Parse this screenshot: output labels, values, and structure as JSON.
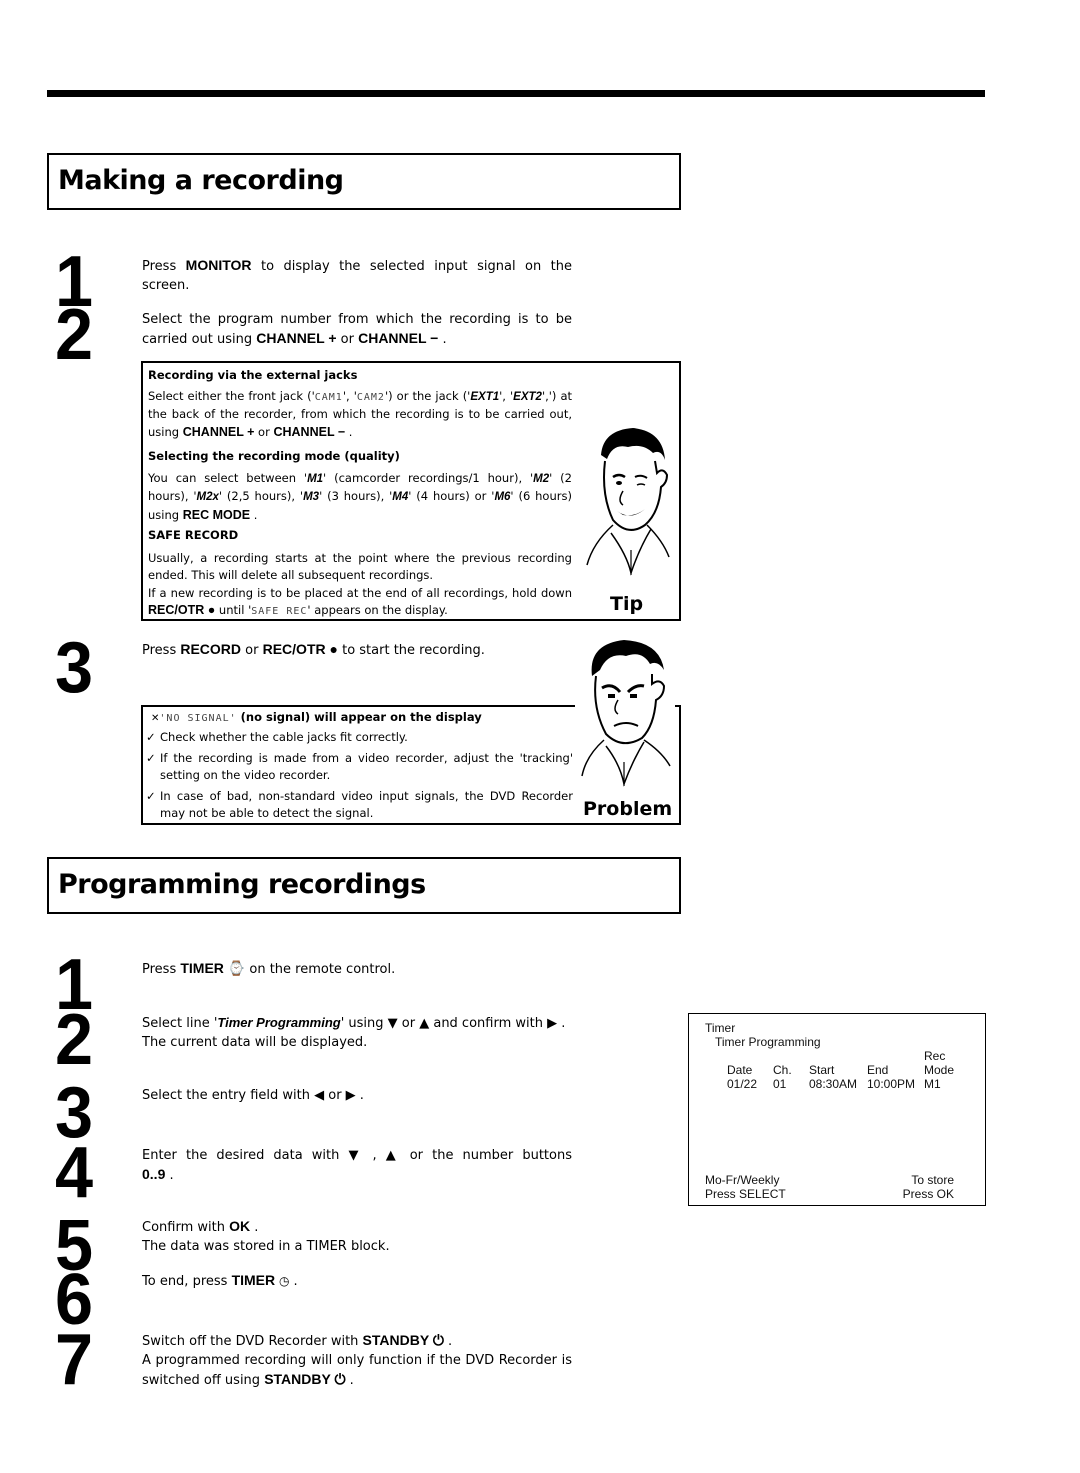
{
  "section1": {
    "title": "Making a recording",
    "steps": [
      {
        "num": "1",
        "pre": "Press ",
        "key": "MONITOR",
        "post": " to display the selected input signal on the screen."
      },
      {
        "num": "2",
        "pre": "Select the program number from which the recording is to be carried out using ",
        "key1": "CHANNEL +",
        "mid": " or ",
        "key2": "CHANNEL −",
        "post": " ."
      },
      {
        "num": "3",
        "pre": "Press ",
        "key1": "RECORD",
        "mid": " or ",
        "key2": "REC/OTR ●",
        "post": " to start the recording."
      }
    ],
    "tip": {
      "label": "Tip",
      "blocks": [
        {
          "heading": "Recording via the external jacks",
          "text_a": "Select either the front jack ('",
          "lcd1": "CAM1",
          "text_b": "', '",
          "lcd2": "CAM2",
          "text_c": "') or the jack ('",
          "bi1": "EXT1",
          "text_d": "', '",
          "bi2": "EXT2",
          "text_e": "',') at the back of the recorder, from which the recording is to be carried out, using ",
          "key1": "CHANNEL +",
          "mid": " or ",
          "key2": "CHANNEL −",
          "end": " ."
        },
        {
          "heading": "Selecting the recording mode (quality)",
          "text": "You can select between 'M1' (camcorder recordings/1 hour), 'M2' (2 hours), 'M2x' (2,5 hours), 'M3' (3 hours), 'M4' (4 hours) or 'M6' (6 hours) using",
          "modes": [
            "M1",
            "M2",
            "M2x",
            "M3",
            "M4",
            "M6"
          ],
          "mode_desc": [
            "camcorder recordings/1 hour",
            "2 hours",
            "2,5 hours",
            "3 hours",
            "4 hours",
            "6 hours"
          ],
          "key": "REC MODE"
        },
        {
          "heading": "SAFE RECORD",
          "text1": "Usually, a recording starts at the point where the previous recording ended. This will delete all subsequent recordings.",
          "text2_a": "If a new recording is to be placed at the end of all recordings, hold down ",
          "key": "REC/OTR ●",
          "text2_b": " until '",
          "lcd": "SAFE REC",
          "text2_c": "' appears on the display."
        }
      ]
    },
    "problem": {
      "label": "Problem",
      "heading_lcd": "NO SIGNAL",
      "heading_text": " (no signal) will appear on the display",
      "items": [
        "Check whether the cable jacks fit correctly.",
        "If the recording is made from a video recorder, adjust the 'tracking' setting on the video recorder.",
        "In case of bad, non-standard video input signals, the DVD Recorder may not be able to detect the signal."
      ]
    }
  },
  "section2": {
    "title": "Programming recordings",
    "steps": [
      {
        "num": "1",
        "pre": "Press ",
        "key": "TIMER ⌚",
        "post": " on the remote control."
      },
      {
        "num": "2",
        "pre": "Select line '",
        "italic": "Timer Programming",
        "mid": "' using ▼ or ▲ and confirm with ▶ .",
        "line2": "The current data will be displayed."
      },
      {
        "num": "3",
        "text": "Select the entry field with ◀ or ▶ ."
      },
      {
        "num": "4",
        "text": "Enter the desired data with ▼ , ▲ or the number buttons",
        "key": "0..9"
      },
      {
        "num": "5",
        "pre": "Confirm with ",
        "key": "OK",
        "post": " .",
        "line2": "The data was stored in a TIMER block."
      },
      {
        "num": "6",
        "pre": "To end, press ",
        "key": "TIMER",
        "post": " ."
      },
      {
        "num": "7",
        "pre": "Switch off the DVD Recorder with ",
        "key": "STANDBY ⏻",
        "post": " .",
        "line2_pre": "A programmed recording will only function if the DVD Recorder is switched off using ",
        "line2_key": "STANDBY ⏻",
        "line2_post": " ."
      }
    ],
    "osd": {
      "title": "Timer",
      "subtitle": "Timer Programming",
      "columns": [
        "Date",
        "Ch.",
        "Start",
        "End",
        "Rec Mode"
      ],
      "col_rec": "Rec",
      "col_mode": "Mode",
      "row": [
        "01/22",
        "01",
        "08:30AM",
        "10:00PM",
        "M1"
      ],
      "footer_left": [
        "Mo-Fr/Weekly",
        "Press SELECT"
      ],
      "footer_right": [
        "To store",
        "Press OK"
      ]
    }
  }
}
